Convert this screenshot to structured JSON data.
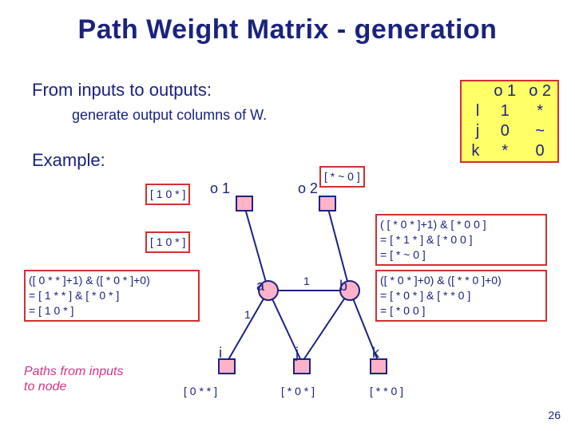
{
  "title": "Path Weight Matrix - generation",
  "intro": "From inputs to outputs:",
  "sub": "generate output columns of W.",
  "example": "Example:",
  "matrix": {
    "cols": [
      "o 1",
      "o 2"
    ],
    "rows": [
      {
        "h": "l",
        "c": [
          "1",
          "*"
        ]
      },
      {
        "h": "j",
        "c": [
          "0",
          "~"
        ]
      },
      {
        "h": "k",
        "c": [
          "*",
          "0"
        ]
      }
    ]
  },
  "ann": {
    "o1": "[ 1 0 * ]",
    "o2vec": "[ * ~ 0 ]",
    "left_a": "[ 1 0 * ]",
    "left_block_l1": "([ 0 * * ]+1) & ([ * 0 * ]+0)",
    "left_block_l2": "= [ 1 * * ] & [ * 0 * ]",
    "left_block_l3": "= [ 1 0 * ]",
    "right_top_l1": "( [ * 0 * ]+1) & [ * 0 0 ]",
    "right_top_l2": "= [ * 1 * ] & [ * 0 0 ]",
    "right_top_l3": "= [ * ~ 0 ]",
    "right_block_l1": "([ * 0 * ]+0) & ([ * * 0 ]+0)",
    "right_block_l2": "= [ * 0 * ] & [ * * 0 ]",
    "right_block_l3": "= [ * 0 0 ]",
    "i": "[ 0 * * ]",
    "j": "[ * 0 * ]",
    "k": "[ * * 0 ]"
  },
  "labels": {
    "o1": "o 1",
    "o2": "o 2",
    "a": "a",
    "b": "b",
    "i": "i",
    "j": "j",
    "k": "k",
    "edge_ia": "1",
    "edge_ab": "1"
  },
  "paths_note_l1": "Paths from inputs",
  "paths_note_l2": "to node",
  "pagenum": "26"
}
